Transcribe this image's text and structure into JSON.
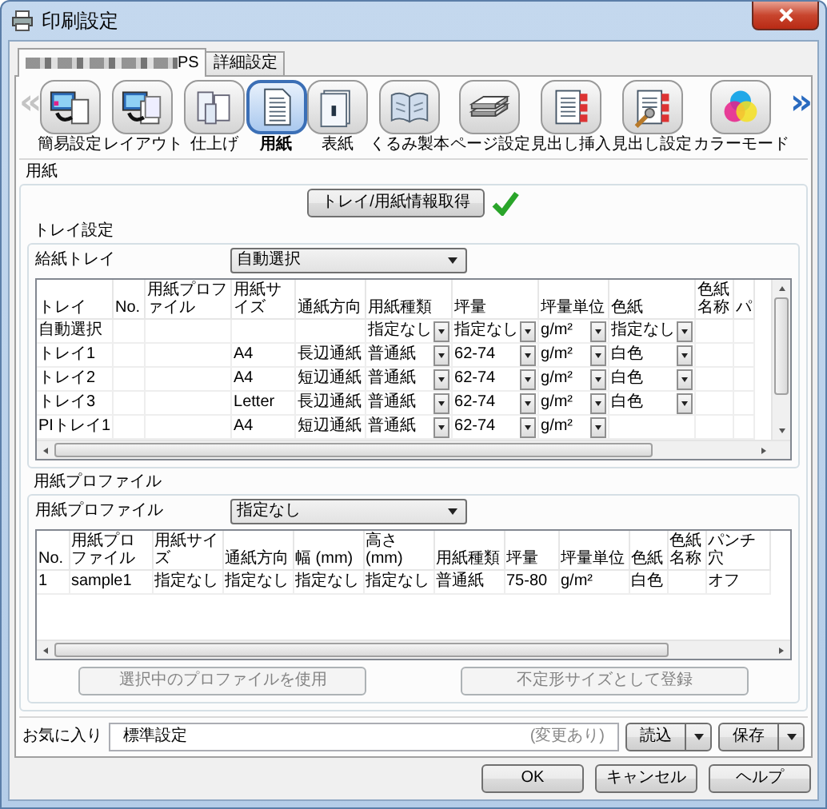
{
  "window": {
    "title": "印刷設定"
  },
  "tabs": [
    {
      "label": "PS",
      "selected": true,
      "redacted": true
    },
    {
      "label": "詳細設定",
      "selected": false,
      "redacted": false
    }
  ],
  "toolbar": {
    "scroll_left": {
      "text": "«",
      "disabled": true
    },
    "scroll_right": {
      "text": "»",
      "disabled": false
    },
    "items": [
      {
        "label": "簡易設定",
        "selected": false
      },
      {
        "label": "レイアウト",
        "selected": false
      },
      {
        "label": "仕上げ",
        "selected": false
      },
      {
        "label": "用紙",
        "selected": true
      },
      {
        "label": "表紙",
        "selected": false
      },
      {
        "label": "くるみ製本",
        "selected": false
      },
      {
        "label": "ページ設定",
        "selected": false
      },
      {
        "label": "見出し挿入",
        "selected": false
      },
      {
        "label": "見出し設定",
        "selected": false
      },
      {
        "label": "カラーモード",
        "selected": false
      }
    ]
  },
  "paper": {
    "title": "用紙",
    "fetch_button": "トレイ/用紙情報取得",
    "fetch_ok": true
  },
  "tray_settings": {
    "title": "トレイ設定",
    "feed_tray": {
      "label": "給紙トレイ",
      "value": "自動選択"
    },
    "table": {
      "columns": [
        "トレイ",
        "No.",
        "用紙プロファイル",
        "用紙サイズ",
        "通紙方向",
        "用紙種類",
        "坪量",
        "坪量単位",
        "色紙",
        "色紙名称",
        "パ"
      ],
      "rows": [
        {
          "cells": [
            {
              "kind": "text",
              "text": "自動選択"
            },
            {
              "kind": "blank"
            },
            {
              "kind": "blank"
            },
            {
              "kind": "blank"
            },
            {
              "kind": "blank"
            },
            {
              "kind": "dropdown",
              "text": "指定なし"
            },
            {
              "kind": "dropdown",
              "text": "指定なし"
            },
            {
              "kind": "dropdown",
              "text": "g/m²"
            },
            {
              "kind": "dropdown",
              "text": "指定なし"
            },
            {
              "kind": "blank"
            },
            {
              "kind": "blank"
            }
          ]
        },
        {
          "cells": [
            {
              "kind": "text",
              "text": "トレイ1"
            },
            {
              "kind": "blank"
            },
            {
              "kind": "blank"
            },
            {
              "kind": "text",
              "text": "A4"
            },
            {
              "kind": "text",
              "text": "長辺通紙"
            },
            {
              "kind": "dropdown",
              "text": "普通紙"
            },
            {
              "kind": "dropdown",
              "text": "62-74"
            },
            {
              "kind": "dropdown",
              "text": "g/m²"
            },
            {
              "kind": "dropdown",
              "text": "白色"
            },
            {
              "kind": "blank"
            },
            {
              "kind": "blank"
            }
          ]
        },
        {
          "cells": [
            {
              "kind": "text",
              "text": "トレイ2"
            },
            {
              "kind": "blank"
            },
            {
              "kind": "blank"
            },
            {
              "kind": "text",
              "text": "A4"
            },
            {
              "kind": "text",
              "text": "短辺通紙"
            },
            {
              "kind": "dropdown",
              "text": "普通紙"
            },
            {
              "kind": "dropdown",
              "text": "62-74"
            },
            {
              "kind": "dropdown",
              "text": "g/m²"
            },
            {
              "kind": "dropdown",
              "text": "白色"
            },
            {
              "kind": "blank"
            },
            {
              "kind": "blank"
            }
          ]
        },
        {
          "cells": [
            {
              "kind": "text",
              "text": "トレイ3"
            },
            {
              "kind": "blank"
            },
            {
              "kind": "blank"
            },
            {
              "kind": "text",
              "text": "Letter"
            },
            {
              "kind": "text",
              "text": "長辺通紙"
            },
            {
              "kind": "dropdown",
              "text": "普通紙"
            },
            {
              "kind": "dropdown",
              "text": "62-74"
            },
            {
              "kind": "dropdown",
              "text": "g/m²"
            },
            {
              "kind": "dropdown",
              "text": "白色"
            },
            {
              "kind": "blank"
            },
            {
              "kind": "blank"
            }
          ]
        },
        {
          "cells": [
            {
              "kind": "text",
              "text": "PIトレイ1"
            },
            {
              "kind": "blank"
            },
            {
              "kind": "blank"
            },
            {
              "kind": "text",
              "text": "A4"
            },
            {
              "kind": "text",
              "text": "短辺通紙"
            },
            {
              "kind": "dropdown",
              "text": "普通紙"
            },
            {
              "kind": "dropdown",
              "text": "62-74"
            },
            {
              "kind": "dropdown",
              "text": "g/m²"
            },
            {
              "kind": "blank"
            },
            {
              "kind": "blank"
            },
            {
              "kind": "blank"
            }
          ]
        }
      ]
    }
  },
  "profiles": {
    "title": "用紙プロファイル",
    "profile": {
      "label": "用紙プロファイル",
      "value": "指定なし"
    },
    "table": {
      "columns": [
        "No.",
        "用紙プロファイル",
        "用紙サイズ",
        "通紙方向",
        "幅 (mm)",
        "高さ (mm)",
        "用紙種類",
        "坪量",
        "坪量単位",
        "色紙",
        "色紙名称",
        "パンチ穴"
      ],
      "rows": [
        {
          "cells": [
            {
              "kind": "text",
              "text": "1"
            },
            {
              "kind": "text",
              "text": "sample1"
            },
            {
              "kind": "text",
              "text": "指定なし"
            },
            {
              "kind": "text",
              "text": "指定なし"
            },
            {
              "kind": "text",
              "text": "指定なし"
            },
            {
              "kind": "text",
              "text": "指定なし"
            },
            {
              "kind": "text",
              "text": "普通紙"
            },
            {
              "kind": "text",
              "text": "75-80"
            },
            {
              "kind": "text",
              "text": "g/m²"
            },
            {
              "kind": "text",
              "text": "白色"
            },
            {
              "kind": "blank"
            },
            {
              "kind": "text",
              "text": "オフ"
            }
          ]
        }
      ]
    },
    "buttons": [
      {
        "label": "選択中のプロファイルを使用",
        "disabled": true
      },
      {
        "label": "不定形サイズとして登録",
        "disabled": true
      }
    ]
  },
  "favorites": {
    "label": "お気に入り",
    "value": "標準設定",
    "note": "(変更あり)",
    "buttons": [
      "読込",
      "保存"
    ]
  },
  "buttons": [
    "OK",
    "キャンセル",
    "ヘルプ"
  ]
}
